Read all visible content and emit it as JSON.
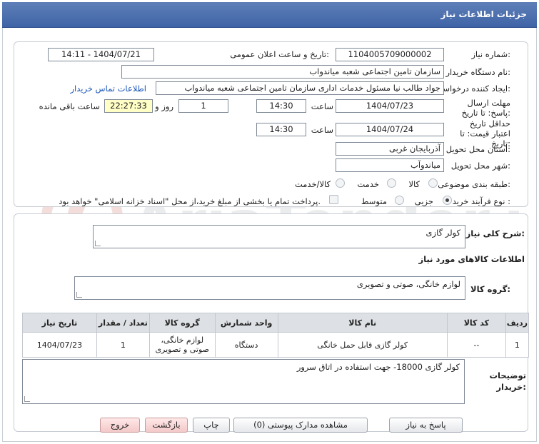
{
  "header": {
    "title": "جزئیات اطلاعات نیاز"
  },
  "watermark": {
    "text": "AriaTender.net"
  },
  "form": {
    "need_number_label": "شماره نیاز:",
    "need_number": "1104005709000002",
    "announce_label": "تاریخ و ساعت اعلان عمومی:",
    "announce_value": "1404/07/21 - 14:11",
    "buyer_org_label": "نام دستگاه خریدار:",
    "buyer_org": "سازمان تامین اجتماعی شعبه میاندواب",
    "requester_label": "ایجاد کننده درخواست:",
    "requester": "جواد طالب نیا مسئول خدمات اداری سازمان تامین اجتماعی شعبه میاندواب",
    "contact_link": "اطلاعات تماس خریدار",
    "deadline_label": "مهلت ارسال پاسخ: تا تاریخ:",
    "deadline_date": "1404/07/23",
    "time_label": "ساعت",
    "deadline_time": "14:30",
    "days_value": "1",
    "days_label": "روز و",
    "remaining_time": "22:27:33",
    "remaining_label": "ساعت باقی مانده",
    "validity_label": "حداقل تاریخ اعتبار قیمت: تا تاریخ:",
    "validity_date": "1404/07/24",
    "validity_time": "14:30",
    "province_label": "استان محل تحویل:",
    "province": "آذربایجان غربی",
    "city_label": "شهر محل تحویل:",
    "city": "میاندوآب",
    "category_label": "طبقه بندی موضوعی:",
    "category_options": [
      "کالا",
      "خدمت",
      "کالا/خدمت"
    ],
    "process_label": "نوع فرآیند خرید :",
    "process_options": [
      "جزیی",
      "متوسط"
    ],
    "payment_note": "پرداخت تمام یا بخشی از مبلغ خرید،از محل \"اسناد خزانه اسلامی\" خواهد بود."
  },
  "summary": {
    "label": "شرح کلی نیاز:",
    "value": "کولر گازی"
  },
  "goods": {
    "section_title": "اطلاعات کالاهای مورد نیاز",
    "group_label": "گروه کالا:",
    "group_value": "لوازم خانگی، صوتی و تصویری",
    "columns": [
      "ردیف",
      "کد کالا",
      "نام کالا",
      "واحد شمارش",
      "گروه کالا",
      "تعداد / مقدار",
      "تاریخ نیاز"
    ],
    "rows": [
      {
        "row": "1",
        "code": "--",
        "name": "کولر گازی قابل حمل خانگی",
        "unit": "دستگاه",
        "group_line1": "لوازم خانگی،",
        "group_line2": "صوتی و تصویری",
        "qty": "1",
        "date": "1404/07/23"
      }
    ]
  },
  "notes": {
    "label": "توضیحات خریدار:",
    "value": "کولر گازی 18000- جهت استفاده در اتاق سرور"
  },
  "buttons": {
    "reply": "پاسخ به نیاز",
    "attachments": "مشاهده مدارک پیوستی (0)",
    "print": "چاپ",
    "back": "بازگشت",
    "exit": "خروج"
  }
}
